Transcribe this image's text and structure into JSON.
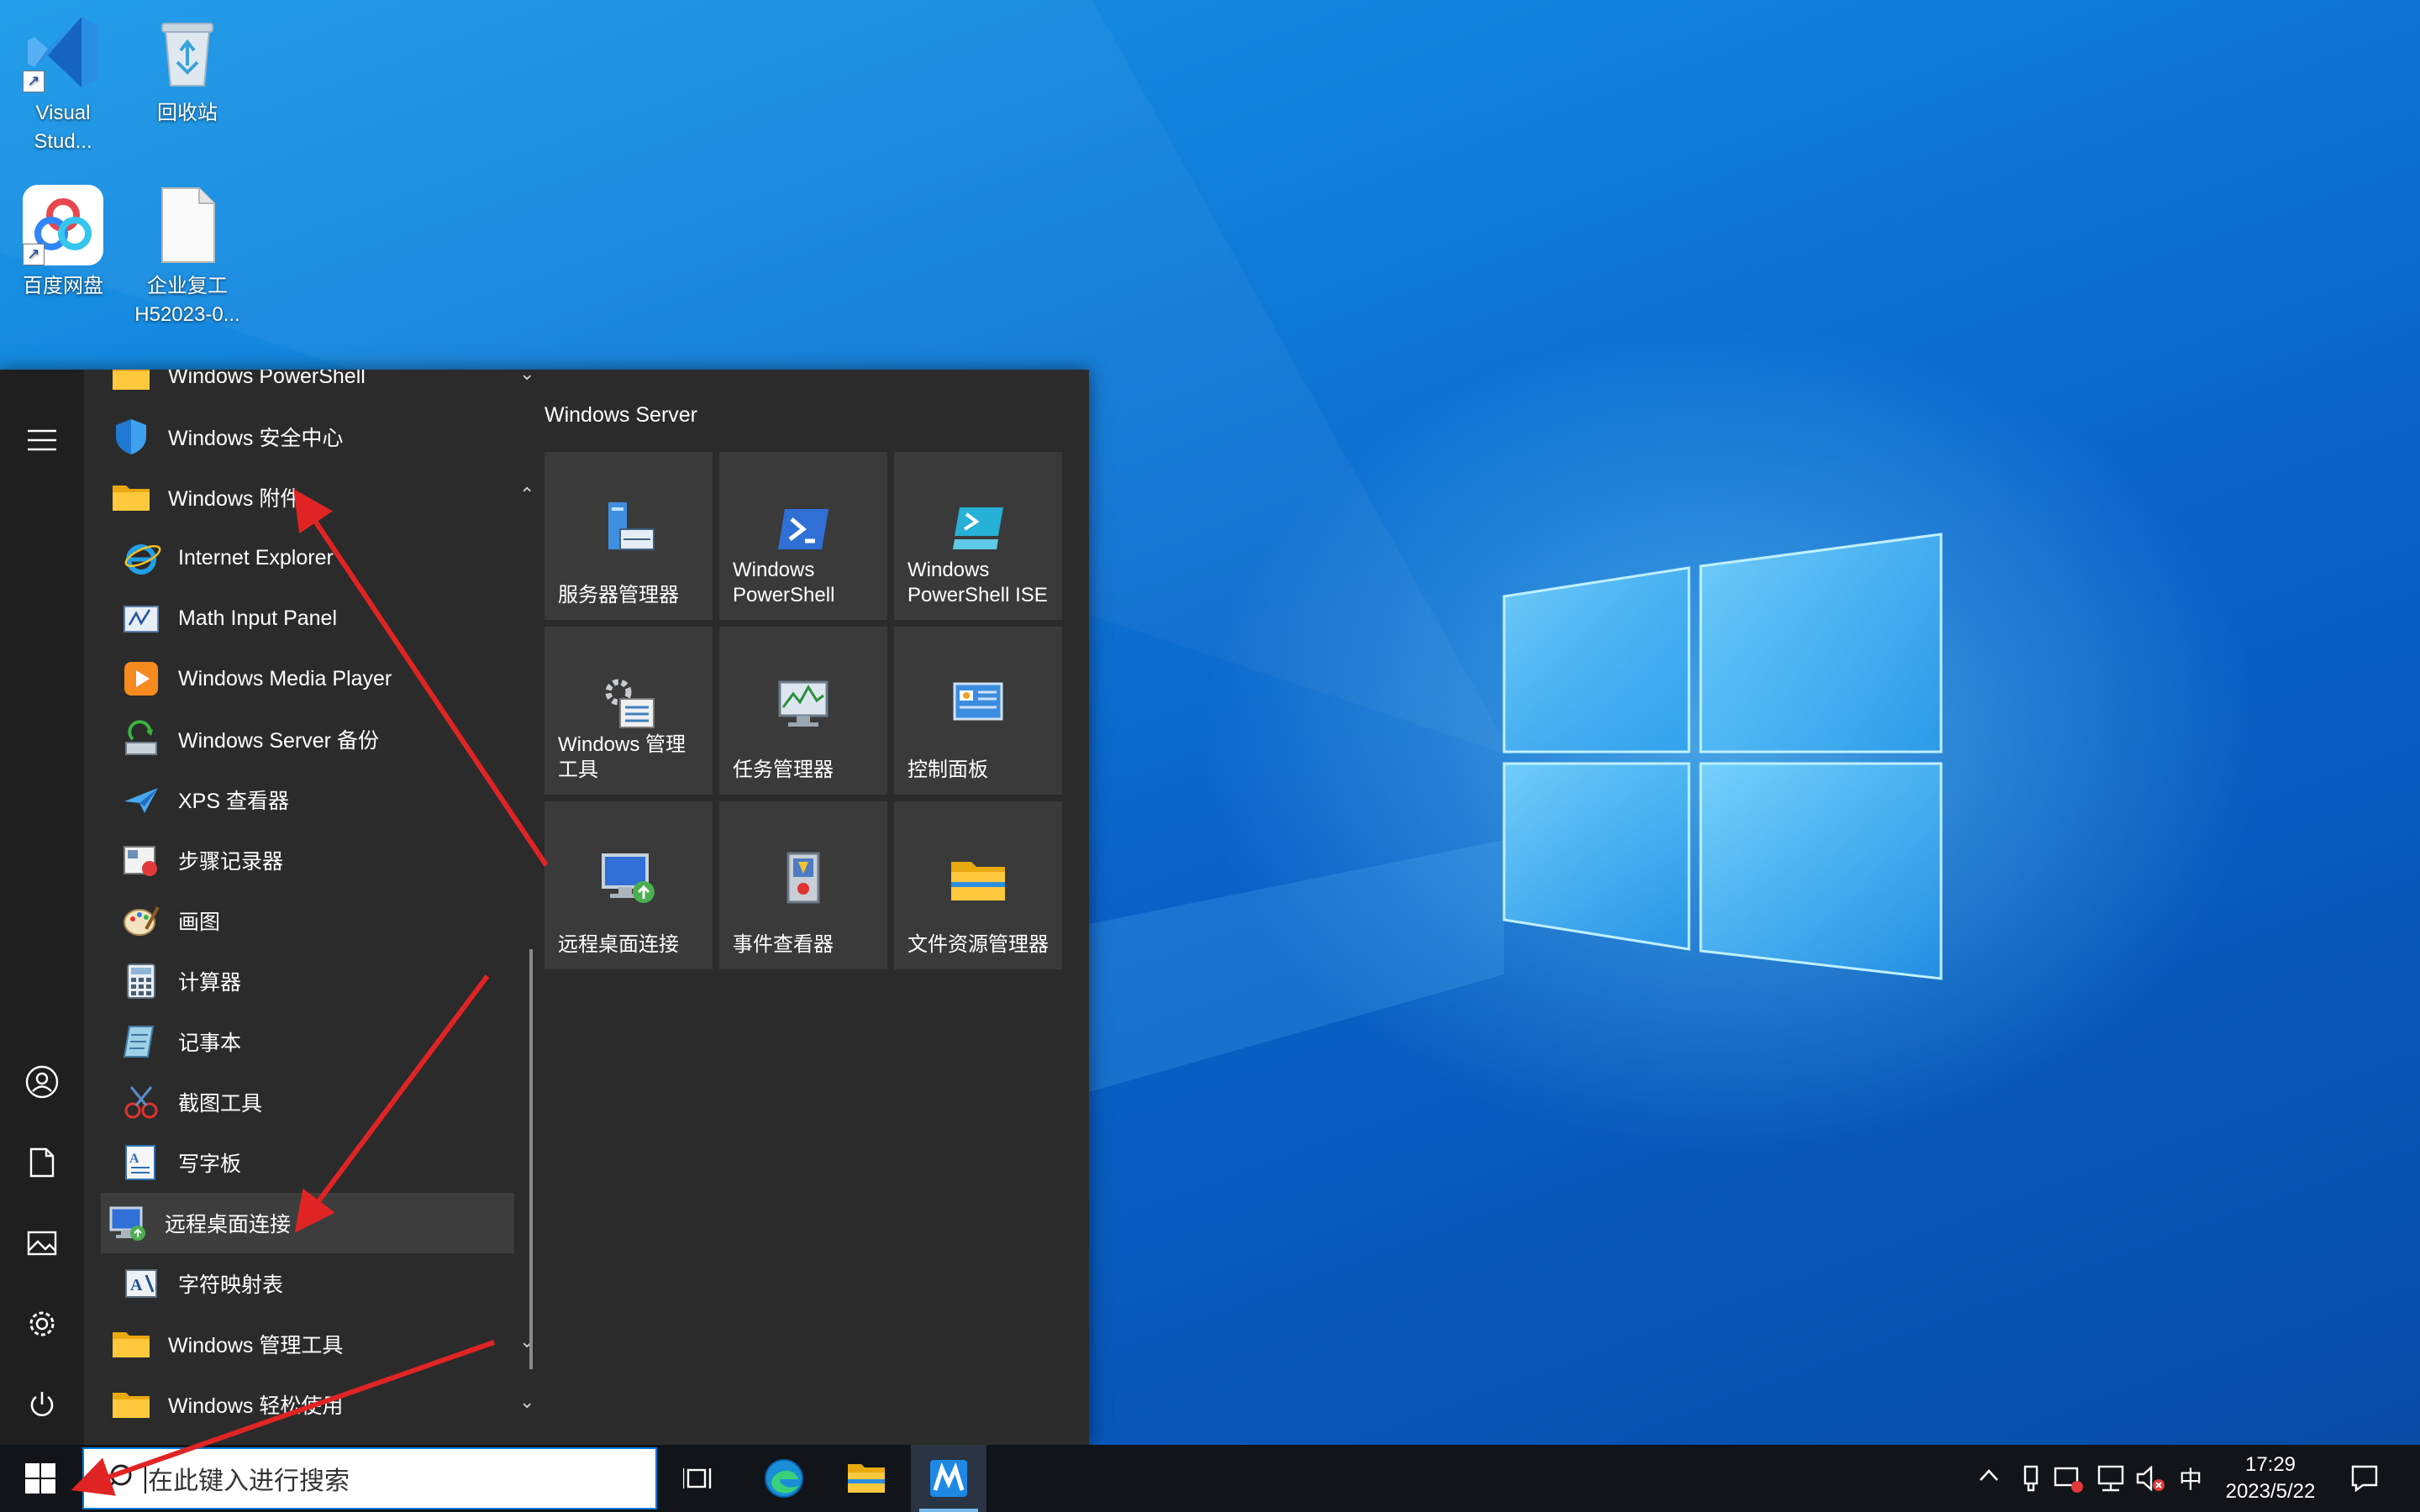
{
  "desktop": {
    "icons": [
      {
        "label_line1": "Visual",
        "label_line2": "Stud...",
        "icon": "vscode-icon"
      },
      {
        "label_line1": "回收站",
        "label_line2": "",
        "icon": "recycle-bin-icon"
      },
      {
        "label_line1": "百度网盘",
        "label_line2": "",
        "icon": "baidu-netdisk-icon"
      },
      {
        "label_line1": "企业复工",
        "label_line2": "H52023-0...",
        "icon": "blank-file-icon"
      }
    ]
  },
  "start_menu": {
    "apps": [
      {
        "label": "Windows PowerShell",
        "icon": "folder-icon",
        "chevron": "down"
      },
      {
        "label": "Windows 安全中心",
        "icon": "shield-icon"
      },
      {
        "label": "Windows 附件",
        "icon": "folder-icon",
        "chevron": "up"
      },
      {
        "label": "Internet Explorer",
        "icon": "internet-explorer-icon"
      },
      {
        "label": "Math Input Panel",
        "icon": "math-input-icon"
      },
      {
        "label": "Windows Media Player",
        "icon": "media-player-icon"
      },
      {
        "label": "Windows Server 备份",
        "icon": "server-backup-icon"
      },
      {
        "label": "XPS 查看器",
        "icon": "xps-viewer-icon"
      },
      {
        "label": "步骤记录器",
        "icon": "steps-recorder-icon"
      },
      {
        "label": "画图",
        "icon": "paint-icon"
      },
      {
        "label": "计算器",
        "icon": "calculator-icon"
      },
      {
        "label": "记事本",
        "icon": "notepad-icon"
      },
      {
        "label": "截图工具",
        "icon": "snipping-tool-icon"
      },
      {
        "label": "写字板",
        "icon": "wordpad-icon"
      },
      {
        "label": "远程桌面连接",
        "icon": "remote-desktop-icon"
      },
      {
        "label": "字符映射表",
        "icon": "character-map-icon"
      },
      {
        "label": "Windows 管理工具",
        "icon": "folder-icon",
        "chevron": "down"
      },
      {
        "label": "Windows 轻松使用",
        "icon": "folder-icon",
        "chevron": "down"
      }
    ],
    "tiles_group": "Windows Server",
    "tiles": [
      {
        "line1": "服务器管理器",
        "line2": "",
        "icon": "server-manager-icon"
      },
      {
        "line1": "Windows",
        "line2": "PowerShell",
        "icon": "powershell-icon"
      },
      {
        "line1": "Windows",
        "line2": "PowerShell ISE",
        "icon": "powershell-ise-icon"
      },
      {
        "line1": "Windows 管理",
        "line2": "工具",
        "icon": "admin-tools-icon"
      },
      {
        "line1": "任务管理器",
        "line2": "",
        "icon": "task-manager-icon"
      },
      {
        "line1": "控制面板",
        "line2": "",
        "icon": "control-panel-icon"
      },
      {
        "line1": "远程桌面连接",
        "line2": "",
        "icon": "remote-desktop-icon"
      },
      {
        "line1": "事件查看器",
        "line2": "",
        "icon": "event-viewer-icon"
      },
      {
        "line1": "文件资源管理器",
        "line2": "",
        "icon": "file-explorer-icon"
      }
    ]
  },
  "taskbar": {
    "search_placeholder": "在此键入进行搜索",
    "ime_label": "中",
    "time": "17:29",
    "date": "2023/5/22"
  }
}
